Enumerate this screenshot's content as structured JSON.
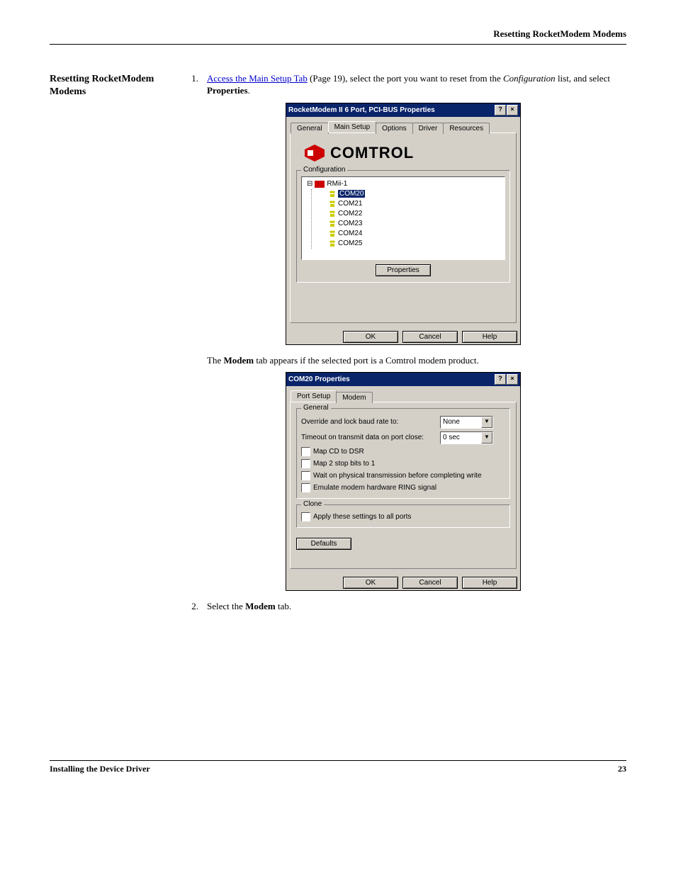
{
  "header": {
    "section": "Resetting RocketModem Modems"
  },
  "sidebar": {
    "heading": "Resetting RocketModem Modems"
  },
  "steps": {
    "1": {
      "num": "1.",
      "link": "Access the Main Setup Tab",
      "after_link": " (Page 19), select the port you want to reset from the ",
      "italic1": "Configuration",
      "after_italic": " list, and select ",
      "bold1": "Properties",
      "period": "."
    },
    "para1_a": "The ",
    "para1_bold": "Modem",
    "para1_b": " tab appears if the selected port is a Comtrol modem product.",
    "2": {
      "num": "2.",
      "a": "Select the ",
      "bold": "Modem",
      "b": " tab."
    }
  },
  "dialog1": {
    "title": "RocketModem II 6 Port, PCI-BUS Properties",
    "tabs": [
      "General",
      "Main Setup",
      "Options",
      "Driver",
      "Resources"
    ],
    "logo": "COMTROL",
    "group": "Configuration",
    "tree": {
      "root_prefix": "⊟",
      "root": "RMii-1",
      "items": [
        "COM20",
        "COM21",
        "COM22",
        "COM23",
        "COM24",
        "COM25"
      ]
    },
    "properties_btn": "Properties",
    "ok": "OK",
    "cancel": "Cancel",
    "help": "Help"
  },
  "dialog2": {
    "title": "COM20 Properties",
    "tabs": [
      "Port Setup",
      "Modem"
    ],
    "group_general": "General",
    "row_override": "Override and lock baud rate to:",
    "row_override_val": "None",
    "row_timeout": "Timeout on transmit data on port close:",
    "row_timeout_val": "0 sec",
    "chk1": "Map CD to DSR",
    "chk2": "Map 2 stop bits to 1",
    "chk3": "Wait on physical transmission before completing write",
    "chk4": "Emulate modem hardware RING signal",
    "group_clone": "Clone",
    "chk_clone": "Apply these settings to all ports",
    "defaults": "Defaults",
    "ok": "OK",
    "cancel": "Cancel",
    "help": "Help"
  },
  "footer": {
    "left": "Installing the Device Driver",
    "right": "23"
  }
}
